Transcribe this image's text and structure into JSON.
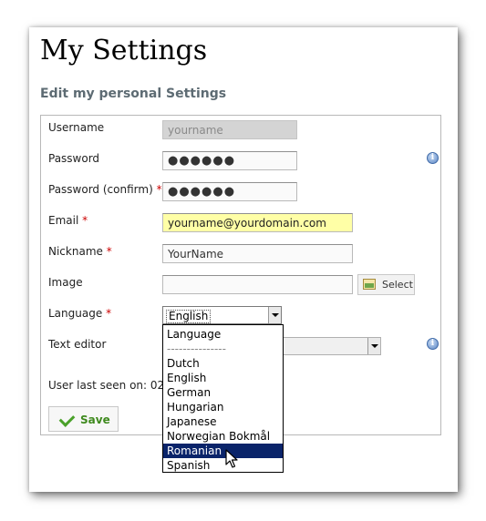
{
  "page": {
    "title": "My Settings",
    "subtitle": "Edit my personal Settings"
  },
  "form": {
    "username": {
      "label": "Username",
      "value": "yourname"
    },
    "password": {
      "label": "Password",
      "value": "●●●●●●"
    },
    "password_confirm": {
      "label": "Password (confirm)",
      "required_mark": "*",
      "value": "●●●●●●"
    },
    "email": {
      "label": "Email",
      "required_mark": "*",
      "value": "yourname@yourdomain.com"
    },
    "nickname": {
      "label": "Nickname",
      "required_mark": "*",
      "value": "YourName"
    },
    "image": {
      "label": "Image",
      "value": "",
      "select_label": "Select"
    },
    "language": {
      "label": "Language",
      "required_mark": "*",
      "value": "English",
      "options": [
        "Language",
        "---------------",
        "Dutch",
        "English",
        "German",
        "Hungarian",
        "Japanese",
        "Norwegian Bokmål",
        "Romanian",
        "Spanish"
      ],
      "highlighted": "Romanian"
    },
    "text_editor": {
      "label": "Text editor",
      "value": ""
    },
    "last_seen": "User last seen on: 02-0",
    "save_label": "Save"
  },
  "icons": {
    "info": "info-icon",
    "select": "image-select-icon",
    "save": "checkmark-icon",
    "cursor": "mouse-pointer-icon"
  },
  "colors": {
    "required": "#cc0000",
    "subtitle": "#5d6b73",
    "email_highlight": "#ffffa6",
    "selected_option": "#0a246a",
    "save_text": "#3f8a1e"
  }
}
